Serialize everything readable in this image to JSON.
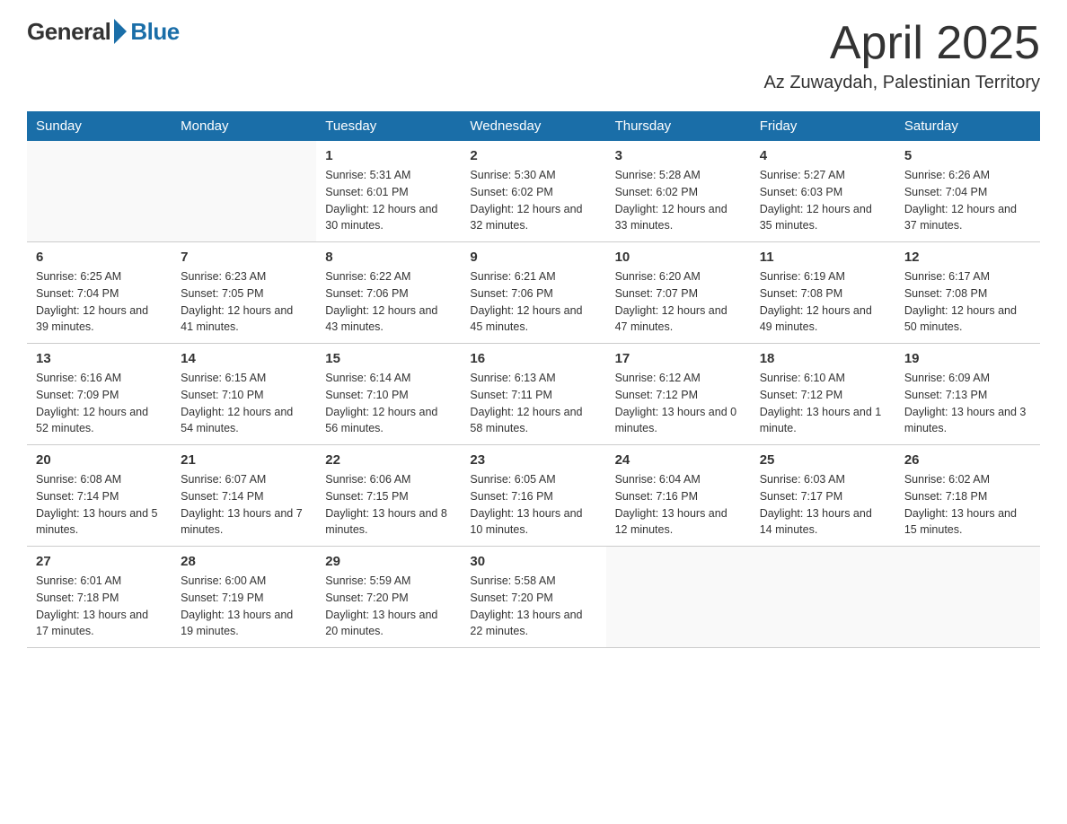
{
  "header": {
    "month_title": "April 2025",
    "location": "Az Zuwaydah, Palestinian Territory",
    "logo_general": "General",
    "logo_blue": "Blue"
  },
  "days_of_week": [
    "Sunday",
    "Monday",
    "Tuesday",
    "Wednesday",
    "Thursday",
    "Friday",
    "Saturday"
  ],
  "weeks": [
    [
      {
        "day": "",
        "sunrise": "",
        "sunset": "",
        "daylight": ""
      },
      {
        "day": "",
        "sunrise": "",
        "sunset": "",
        "daylight": ""
      },
      {
        "day": "1",
        "sunrise": "Sunrise: 5:31 AM",
        "sunset": "Sunset: 6:01 PM",
        "daylight": "Daylight: 12 hours and 30 minutes."
      },
      {
        "day": "2",
        "sunrise": "Sunrise: 5:30 AM",
        "sunset": "Sunset: 6:02 PM",
        "daylight": "Daylight: 12 hours and 32 minutes."
      },
      {
        "day": "3",
        "sunrise": "Sunrise: 5:28 AM",
        "sunset": "Sunset: 6:02 PM",
        "daylight": "Daylight: 12 hours and 33 minutes."
      },
      {
        "day": "4",
        "sunrise": "Sunrise: 5:27 AM",
        "sunset": "Sunset: 6:03 PM",
        "daylight": "Daylight: 12 hours and 35 minutes."
      },
      {
        "day": "5",
        "sunrise": "Sunrise: 6:26 AM",
        "sunset": "Sunset: 7:04 PM",
        "daylight": "Daylight: 12 hours and 37 minutes."
      }
    ],
    [
      {
        "day": "6",
        "sunrise": "Sunrise: 6:25 AM",
        "sunset": "Sunset: 7:04 PM",
        "daylight": "Daylight: 12 hours and 39 minutes."
      },
      {
        "day": "7",
        "sunrise": "Sunrise: 6:23 AM",
        "sunset": "Sunset: 7:05 PM",
        "daylight": "Daylight: 12 hours and 41 minutes."
      },
      {
        "day": "8",
        "sunrise": "Sunrise: 6:22 AM",
        "sunset": "Sunset: 7:06 PM",
        "daylight": "Daylight: 12 hours and 43 minutes."
      },
      {
        "day": "9",
        "sunrise": "Sunrise: 6:21 AM",
        "sunset": "Sunset: 7:06 PM",
        "daylight": "Daylight: 12 hours and 45 minutes."
      },
      {
        "day": "10",
        "sunrise": "Sunrise: 6:20 AM",
        "sunset": "Sunset: 7:07 PM",
        "daylight": "Daylight: 12 hours and 47 minutes."
      },
      {
        "day": "11",
        "sunrise": "Sunrise: 6:19 AM",
        "sunset": "Sunset: 7:08 PM",
        "daylight": "Daylight: 12 hours and 49 minutes."
      },
      {
        "day": "12",
        "sunrise": "Sunrise: 6:17 AM",
        "sunset": "Sunset: 7:08 PM",
        "daylight": "Daylight: 12 hours and 50 minutes."
      }
    ],
    [
      {
        "day": "13",
        "sunrise": "Sunrise: 6:16 AM",
        "sunset": "Sunset: 7:09 PM",
        "daylight": "Daylight: 12 hours and 52 minutes."
      },
      {
        "day": "14",
        "sunrise": "Sunrise: 6:15 AM",
        "sunset": "Sunset: 7:10 PM",
        "daylight": "Daylight: 12 hours and 54 minutes."
      },
      {
        "day": "15",
        "sunrise": "Sunrise: 6:14 AM",
        "sunset": "Sunset: 7:10 PM",
        "daylight": "Daylight: 12 hours and 56 minutes."
      },
      {
        "day": "16",
        "sunrise": "Sunrise: 6:13 AM",
        "sunset": "Sunset: 7:11 PM",
        "daylight": "Daylight: 12 hours and 58 minutes."
      },
      {
        "day": "17",
        "sunrise": "Sunrise: 6:12 AM",
        "sunset": "Sunset: 7:12 PM",
        "daylight": "Daylight: 13 hours and 0 minutes."
      },
      {
        "day": "18",
        "sunrise": "Sunrise: 6:10 AM",
        "sunset": "Sunset: 7:12 PM",
        "daylight": "Daylight: 13 hours and 1 minute."
      },
      {
        "day": "19",
        "sunrise": "Sunrise: 6:09 AM",
        "sunset": "Sunset: 7:13 PM",
        "daylight": "Daylight: 13 hours and 3 minutes."
      }
    ],
    [
      {
        "day": "20",
        "sunrise": "Sunrise: 6:08 AM",
        "sunset": "Sunset: 7:14 PM",
        "daylight": "Daylight: 13 hours and 5 minutes."
      },
      {
        "day": "21",
        "sunrise": "Sunrise: 6:07 AM",
        "sunset": "Sunset: 7:14 PM",
        "daylight": "Daylight: 13 hours and 7 minutes."
      },
      {
        "day": "22",
        "sunrise": "Sunrise: 6:06 AM",
        "sunset": "Sunset: 7:15 PM",
        "daylight": "Daylight: 13 hours and 8 minutes."
      },
      {
        "day": "23",
        "sunrise": "Sunrise: 6:05 AM",
        "sunset": "Sunset: 7:16 PM",
        "daylight": "Daylight: 13 hours and 10 minutes."
      },
      {
        "day": "24",
        "sunrise": "Sunrise: 6:04 AM",
        "sunset": "Sunset: 7:16 PM",
        "daylight": "Daylight: 13 hours and 12 minutes."
      },
      {
        "day": "25",
        "sunrise": "Sunrise: 6:03 AM",
        "sunset": "Sunset: 7:17 PM",
        "daylight": "Daylight: 13 hours and 14 minutes."
      },
      {
        "day": "26",
        "sunrise": "Sunrise: 6:02 AM",
        "sunset": "Sunset: 7:18 PM",
        "daylight": "Daylight: 13 hours and 15 minutes."
      }
    ],
    [
      {
        "day": "27",
        "sunrise": "Sunrise: 6:01 AM",
        "sunset": "Sunset: 7:18 PM",
        "daylight": "Daylight: 13 hours and 17 minutes."
      },
      {
        "day": "28",
        "sunrise": "Sunrise: 6:00 AM",
        "sunset": "Sunset: 7:19 PM",
        "daylight": "Daylight: 13 hours and 19 minutes."
      },
      {
        "day": "29",
        "sunrise": "Sunrise: 5:59 AM",
        "sunset": "Sunset: 7:20 PM",
        "daylight": "Daylight: 13 hours and 20 minutes."
      },
      {
        "day": "30",
        "sunrise": "Sunrise: 5:58 AM",
        "sunset": "Sunset: 7:20 PM",
        "daylight": "Daylight: 13 hours and 22 minutes."
      },
      {
        "day": "",
        "sunrise": "",
        "sunset": "",
        "daylight": ""
      },
      {
        "day": "",
        "sunrise": "",
        "sunset": "",
        "daylight": ""
      },
      {
        "day": "",
        "sunrise": "",
        "sunset": "",
        "daylight": ""
      }
    ]
  ]
}
